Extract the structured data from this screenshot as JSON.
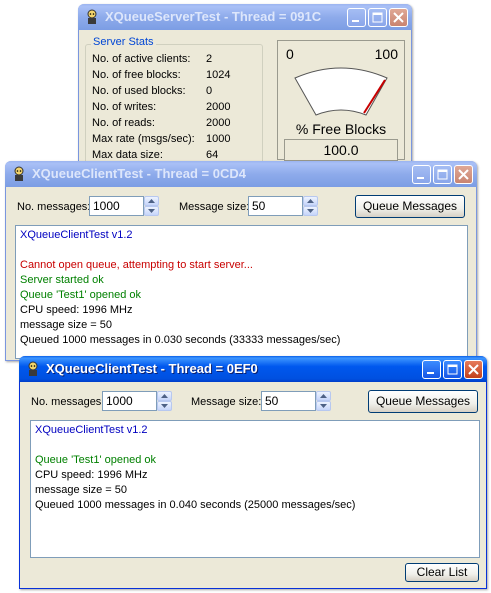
{
  "server_window": {
    "title": "XQueueServerTest - Thread = 091C",
    "stats_group_label": "Server Stats",
    "stats": [
      {
        "label": "No. of active clients:",
        "value": "2"
      },
      {
        "label": "No. of free blocks:",
        "value": "1024"
      },
      {
        "label": "No. of used blocks:",
        "value": "0"
      },
      {
        "label": "No. of writes:",
        "value": "2000"
      },
      {
        "label": "No. of reads:",
        "value": "2000"
      },
      {
        "label": "Max rate (msgs/sec):",
        "value": "1000"
      },
      {
        "label": "Max data size:",
        "value": "64"
      }
    ],
    "gauge": {
      "min_label": "0",
      "max_label": "100",
      "caption": "% Free Blocks",
      "value_text": "100.0",
      "value": 100
    }
  },
  "client_window_1": {
    "title": "XQueueClientTest - Thread = 0CD4",
    "no_messages_label": "No. messages:",
    "no_messages_value": "1000",
    "message_size_label": "Message size:",
    "message_size_value": "50",
    "queue_button": "Queue Messages",
    "log": [
      {
        "text": "XQueueClientTest v1.2",
        "color": "blue"
      },
      {
        "text": "",
        "color": "black"
      },
      {
        "text": "Cannot open queue, attempting to start server...",
        "color": "red"
      },
      {
        "text": "Server started ok",
        "color": "green"
      },
      {
        "text": "Queue 'Test1' opened ok",
        "color": "green"
      },
      {
        "text": "CPU speed: 1996 MHz",
        "color": "black"
      },
      {
        "text": "message size = 50",
        "color": "black"
      },
      {
        "text": "Queued 1000 messages in 0.030 seconds (33333 messages/sec)",
        "color": "black"
      }
    ]
  },
  "client_window_2": {
    "title": "XQueueClientTest - Thread = 0EF0",
    "no_messages_label": "No. messages:",
    "no_messages_value": "1000",
    "message_size_label": "Message size:",
    "message_size_value": "50",
    "queue_button": "Queue Messages",
    "clear_button": "Clear List",
    "log": [
      {
        "text": "XQueueClientTest v1.2",
        "color": "blue"
      },
      {
        "text": "",
        "color": "black"
      },
      {
        "text": "Queue 'Test1' opened ok",
        "color": "green"
      },
      {
        "text": "CPU speed: 1996 MHz",
        "color": "black"
      },
      {
        "text": "message size = 50",
        "color": "black"
      },
      {
        "text": "Queued 1000 messages in 0.040 seconds (25000 messages/sec)",
        "color": "black"
      }
    ]
  },
  "colors": {
    "blue": "#0000c0",
    "red": "#c80000",
    "green": "#008000",
    "black": "#000000",
    "gauge_needle": "#c80000"
  }
}
